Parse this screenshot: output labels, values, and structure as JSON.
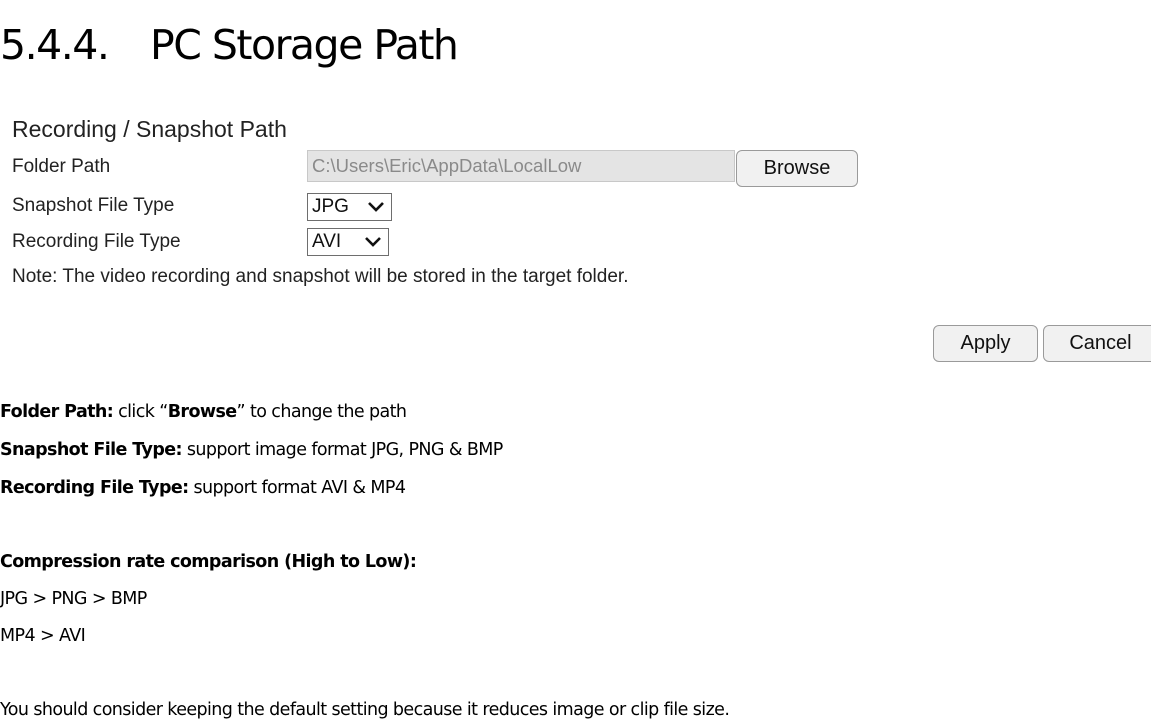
{
  "heading": {
    "number": "5.4.4.",
    "title": "PC Storage Path"
  },
  "panel": {
    "title": "Recording / Snapshot Path",
    "folder_path_label": "Folder Path",
    "folder_path_value": "C:\\Users\\Eric\\AppData\\LocalLow",
    "browse_label": "Browse",
    "snapshot_type_label": "Snapshot File Type",
    "snapshot_type_value": "JPG",
    "recording_type_label": "Recording File Type",
    "recording_type_value": "AVI",
    "note": "Note: The video recording and snapshot will be stored in the target folder.",
    "apply_label": "Apply",
    "cancel_label": "Cancel"
  },
  "description": {
    "folder_path": {
      "term": "Folder Path:",
      "pre": " click “",
      "bold": "Browse",
      "post": "” to change the path"
    },
    "snapshot": {
      "term": "Snapshot File Type:",
      "text": " support image format JPG, PNG & BMP"
    },
    "recording": {
      "term": "Recording File Type:",
      "text": " support format AVI & MP4"
    },
    "compression_heading": "Compression rate comparison (High to Low):",
    "image_order": "JPG > PNG > BMP",
    "video_order": "MP4 > AVI",
    "advice": "You should consider keeping the default setting because it reduces image or clip file size."
  },
  "icons": {
    "dropdown": "chevron-down-icon"
  }
}
